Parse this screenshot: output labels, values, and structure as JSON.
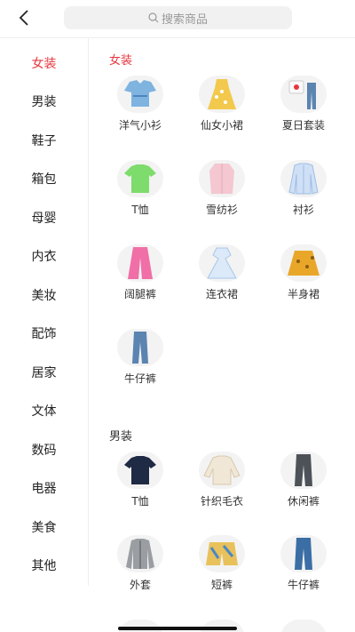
{
  "header": {
    "search_placeholder": "搜索商品",
    "icons": {
      "back": "back-arrow-icon",
      "search": "search-icon"
    }
  },
  "sidebar": {
    "items": [
      {
        "label": "女装",
        "active": true
      },
      {
        "label": "男装"
      },
      {
        "label": "鞋子"
      },
      {
        "label": "箱包"
      },
      {
        "label": "母婴"
      },
      {
        "label": "内衣"
      },
      {
        "label": "美妆"
      },
      {
        "label": "配饰"
      },
      {
        "label": "居家"
      },
      {
        "label": "文体"
      },
      {
        "label": "数码"
      },
      {
        "label": "电器"
      },
      {
        "label": "美食"
      },
      {
        "label": "其他"
      }
    ]
  },
  "sections": [
    {
      "title": "女装",
      "items": [
        "洋气小衫",
        "仙女小裙",
        "夏日套装",
        "T恤",
        "雪纺衫",
        "衬衫",
        "阔腿裤",
        "连衣裙",
        "半身裙",
        "牛仔裤"
      ]
    },
    {
      "title": "男装",
      "items": [
        "T恤",
        "针织毛衣",
        "休闲裤",
        "外套",
        "短裤",
        "牛仔裤"
      ]
    }
  ],
  "colors": {
    "accent": "#e5383f",
    "sidebar_border": "#eeeeee",
    "search_bg": "#f1f1f1"
  }
}
